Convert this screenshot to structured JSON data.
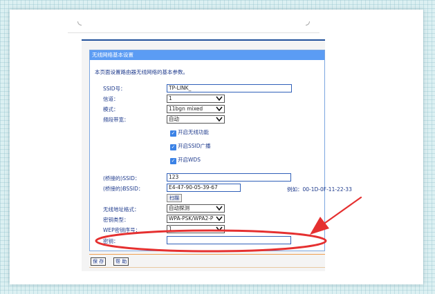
{
  "panel": {
    "title": "无线网络基本设置",
    "description": "本页面设置路由器无线网络的基本参数。"
  },
  "form": {
    "ssid_label": "SSID号：",
    "ssid_value": "TP-LINK_",
    "channel_label": "信道：",
    "channel_value": "1",
    "mode_label": "模式：",
    "mode_value": "11bgn mixed",
    "bandwidth_label": "频段带宽：",
    "bandwidth_value": "自动",
    "enable_wireless": "开启无线功能",
    "enable_ssid_broadcast": "开启SSID广播",
    "enable_wds": "开启WDS",
    "bridged_ssid_label": "(桥接的)SSID：",
    "bridged_ssid_value": "123",
    "bridged_bssid_label": "(桥接的)BSSID：",
    "bridged_bssid_value": "E4-47-90-05-39-67",
    "bssid_example": "例如：00-1D-0F-11-22-33",
    "scan_button": "扫描",
    "address_mode_label": "无线地址格式：",
    "address_mode_value": "自动探测",
    "key_type_label": "密钥类型：",
    "key_type_value": "WPA-PSK/WPA2-P",
    "wep_index_label": "WEP密钥序号：",
    "wep_index_value": "1",
    "key_label": "密钥：",
    "key_value": ""
  },
  "footer": {
    "save_button": "保 存",
    "help_button": "帮 助"
  },
  "colors": {
    "panel_header": "#5b9cf4",
    "annotation_red": "#e53030",
    "checkbox_blue": "#3b82e6"
  }
}
